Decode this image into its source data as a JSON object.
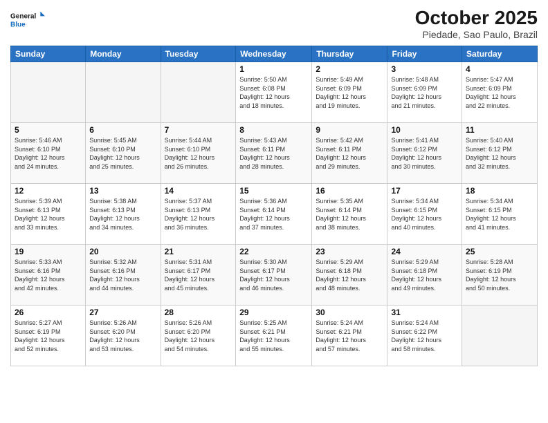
{
  "header": {
    "logo_line1": "General",
    "logo_line2": "Blue",
    "month_title": "October 2025",
    "location": "Piedade, Sao Paulo, Brazil"
  },
  "weekdays": [
    "Sunday",
    "Monday",
    "Tuesday",
    "Wednesday",
    "Thursday",
    "Friday",
    "Saturday"
  ],
  "weeks": [
    [
      {
        "day": "",
        "info": ""
      },
      {
        "day": "",
        "info": ""
      },
      {
        "day": "",
        "info": ""
      },
      {
        "day": "1",
        "info": "Sunrise: 5:50 AM\nSunset: 6:08 PM\nDaylight: 12 hours\nand 18 minutes."
      },
      {
        "day": "2",
        "info": "Sunrise: 5:49 AM\nSunset: 6:09 PM\nDaylight: 12 hours\nand 19 minutes."
      },
      {
        "day": "3",
        "info": "Sunrise: 5:48 AM\nSunset: 6:09 PM\nDaylight: 12 hours\nand 21 minutes."
      },
      {
        "day": "4",
        "info": "Sunrise: 5:47 AM\nSunset: 6:09 PM\nDaylight: 12 hours\nand 22 minutes."
      }
    ],
    [
      {
        "day": "5",
        "info": "Sunrise: 5:46 AM\nSunset: 6:10 PM\nDaylight: 12 hours\nand 24 minutes."
      },
      {
        "day": "6",
        "info": "Sunrise: 5:45 AM\nSunset: 6:10 PM\nDaylight: 12 hours\nand 25 minutes."
      },
      {
        "day": "7",
        "info": "Sunrise: 5:44 AM\nSunset: 6:10 PM\nDaylight: 12 hours\nand 26 minutes."
      },
      {
        "day": "8",
        "info": "Sunrise: 5:43 AM\nSunset: 6:11 PM\nDaylight: 12 hours\nand 28 minutes."
      },
      {
        "day": "9",
        "info": "Sunrise: 5:42 AM\nSunset: 6:11 PM\nDaylight: 12 hours\nand 29 minutes."
      },
      {
        "day": "10",
        "info": "Sunrise: 5:41 AM\nSunset: 6:12 PM\nDaylight: 12 hours\nand 30 minutes."
      },
      {
        "day": "11",
        "info": "Sunrise: 5:40 AM\nSunset: 6:12 PM\nDaylight: 12 hours\nand 32 minutes."
      }
    ],
    [
      {
        "day": "12",
        "info": "Sunrise: 5:39 AM\nSunset: 6:13 PM\nDaylight: 12 hours\nand 33 minutes."
      },
      {
        "day": "13",
        "info": "Sunrise: 5:38 AM\nSunset: 6:13 PM\nDaylight: 12 hours\nand 34 minutes."
      },
      {
        "day": "14",
        "info": "Sunrise: 5:37 AM\nSunset: 6:13 PM\nDaylight: 12 hours\nand 36 minutes."
      },
      {
        "day": "15",
        "info": "Sunrise: 5:36 AM\nSunset: 6:14 PM\nDaylight: 12 hours\nand 37 minutes."
      },
      {
        "day": "16",
        "info": "Sunrise: 5:35 AM\nSunset: 6:14 PM\nDaylight: 12 hours\nand 38 minutes."
      },
      {
        "day": "17",
        "info": "Sunrise: 5:34 AM\nSunset: 6:15 PM\nDaylight: 12 hours\nand 40 minutes."
      },
      {
        "day": "18",
        "info": "Sunrise: 5:34 AM\nSunset: 6:15 PM\nDaylight: 12 hours\nand 41 minutes."
      }
    ],
    [
      {
        "day": "19",
        "info": "Sunrise: 5:33 AM\nSunset: 6:16 PM\nDaylight: 12 hours\nand 42 minutes."
      },
      {
        "day": "20",
        "info": "Sunrise: 5:32 AM\nSunset: 6:16 PM\nDaylight: 12 hours\nand 44 minutes."
      },
      {
        "day": "21",
        "info": "Sunrise: 5:31 AM\nSunset: 6:17 PM\nDaylight: 12 hours\nand 45 minutes."
      },
      {
        "day": "22",
        "info": "Sunrise: 5:30 AM\nSunset: 6:17 PM\nDaylight: 12 hours\nand 46 minutes."
      },
      {
        "day": "23",
        "info": "Sunrise: 5:29 AM\nSunset: 6:18 PM\nDaylight: 12 hours\nand 48 minutes."
      },
      {
        "day": "24",
        "info": "Sunrise: 5:29 AM\nSunset: 6:18 PM\nDaylight: 12 hours\nand 49 minutes."
      },
      {
        "day": "25",
        "info": "Sunrise: 5:28 AM\nSunset: 6:19 PM\nDaylight: 12 hours\nand 50 minutes."
      }
    ],
    [
      {
        "day": "26",
        "info": "Sunrise: 5:27 AM\nSunset: 6:19 PM\nDaylight: 12 hours\nand 52 minutes."
      },
      {
        "day": "27",
        "info": "Sunrise: 5:26 AM\nSunset: 6:20 PM\nDaylight: 12 hours\nand 53 minutes."
      },
      {
        "day": "28",
        "info": "Sunrise: 5:26 AM\nSunset: 6:20 PM\nDaylight: 12 hours\nand 54 minutes."
      },
      {
        "day": "29",
        "info": "Sunrise: 5:25 AM\nSunset: 6:21 PM\nDaylight: 12 hours\nand 55 minutes."
      },
      {
        "day": "30",
        "info": "Sunrise: 5:24 AM\nSunset: 6:21 PM\nDaylight: 12 hours\nand 57 minutes."
      },
      {
        "day": "31",
        "info": "Sunrise: 5:24 AM\nSunset: 6:22 PM\nDaylight: 12 hours\nand 58 minutes."
      },
      {
        "day": "",
        "info": ""
      }
    ]
  ]
}
